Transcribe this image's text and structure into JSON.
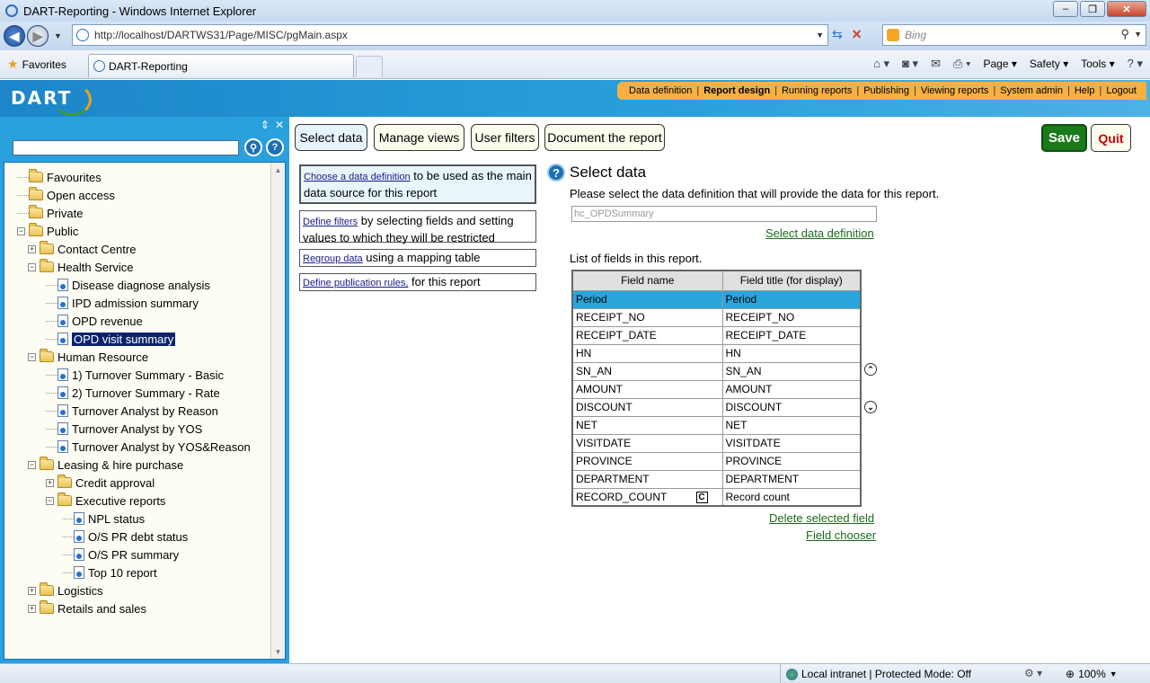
{
  "window": {
    "title": "DART-Reporting - Windows Internet Explorer"
  },
  "browser": {
    "url": "http://localhost/DARTWS31/Page/MISC/pgMain.aspx",
    "search_placeholder": "Bing",
    "favorites_label": "Favorites",
    "tab_title": "DART-Reporting",
    "commands": [
      "Page",
      "Safety",
      "Tools"
    ]
  },
  "app": {
    "logo": "DART",
    "nav": [
      "Data definition",
      "Report design",
      "Running reports",
      "Publishing",
      "Viewing reports",
      "System admin",
      "Help",
      "Logout"
    ],
    "active_nav": "Report design"
  },
  "tree": [
    {
      "label": "Favourites",
      "type": "folder"
    },
    {
      "label": "Open access",
      "type": "folder"
    },
    {
      "label": "Private",
      "type": "folder"
    },
    {
      "label": "Public",
      "type": "folder"
    },
    {
      "label": "Contact Centre",
      "type": "folder"
    },
    {
      "label": "Health Service",
      "type": "folder"
    },
    {
      "label": "Disease diagnose analysis",
      "type": "report"
    },
    {
      "label": "IPD admission summary",
      "type": "report"
    },
    {
      "label": "OPD revenue",
      "type": "report"
    },
    {
      "label": "OPD visit summary",
      "type": "report"
    },
    {
      "label": "Human Resource",
      "type": "folder"
    },
    {
      "label": "1) Turnover Summary - Basic",
      "type": "report"
    },
    {
      "label": "2) Turnover Summary - Rate",
      "type": "report"
    },
    {
      "label": "Turnover Analyst by Reason",
      "type": "report"
    },
    {
      "label": "Turnover Analyst by YOS",
      "type": "report"
    },
    {
      "label": "Turnover Analyst by YOS&Reason",
      "type": "report"
    },
    {
      "label": "Leasing & hire purchase",
      "type": "folder"
    },
    {
      "label": "Credit approval",
      "type": "folder"
    },
    {
      "label": "Executive reports",
      "type": "folder"
    },
    {
      "label": "NPL status",
      "type": "report"
    },
    {
      "label": "O/S PR debt status",
      "type": "report"
    },
    {
      "label": "O/S PR summary",
      "type": "report"
    },
    {
      "label": "Top 10 report",
      "type": "report"
    },
    {
      "label": "Logistics",
      "type": "folder"
    },
    {
      "label": "Retails and sales",
      "type": "folder"
    }
  ],
  "toolbar": {
    "select_data": "Select data",
    "manage_views": "Manage views",
    "user_filters": "User filters",
    "document_report": "Document the report",
    "save": "Save",
    "quit": "Quit"
  },
  "steps": [
    {
      "link": "Choose a data definition",
      "text": " to be used as the main data source for this report"
    },
    {
      "link": "Define filters",
      "text": " by selecting fields and setting values to which they will be restricted"
    },
    {
      "link": "Regroup data",
      "text": " using a mapping table"
    },
    {
      "link": "Define publication rules,",
      "text": " for this report"
    }
  ],
  "main": {
    "title": "Select data",
    "description": "Please select the data definition that will provide the data for this report.",
    "data_definition": "hc_OPDSummary",
    "select_link": "Select data definition",
    "list_label": "List of fields in this report.",
    "col_field": "Field name",
    "col_title": "Field title (for display)",
    "fields": [
      {
        "name": "Period",
        "title": "Period",
        "selected": true
      },
      {
        "name": "RECEIPT_NO",
        "title": "RECEIPT_NO"
      },
      {
        "name": "RECEIPT_DATE",
        "title": "RECEIPT_DATE"
      },
      {
        "name": "HN",
        "title": "HN"
      },
      {
        "name": "SN_AN",
        "title": "SN_AN"
      },
      {
        "name": "AMOUNT",
        "title": "AMOUNT"
      },
      {
        "name": "DISCOUNT",
        "title": "DISCOUNT"
      },
      {
        "name": "NET",
        "title": "NET"
      },
      {
        "name": "VISITDATE",
        "title": "VISITDATE"
      },
      {
        "name": "PROVINCE",
        "title": "PROVINCE"
      },
      {
        "name": "DEPARTMENT",
        "title": "DEPARTMENT"
      },
      {
        "name": "RECORD_COUNT",
        "title": "Record count",
        "badge": "C"
      }
    ],
    "delete_link": "Delete selected field",
    "chooser_link": "Field chooser"
  },
  "status": {
    "zone": "Local intranet | Protected Mode: Off",
    "zoom": "100%"
  }
}
